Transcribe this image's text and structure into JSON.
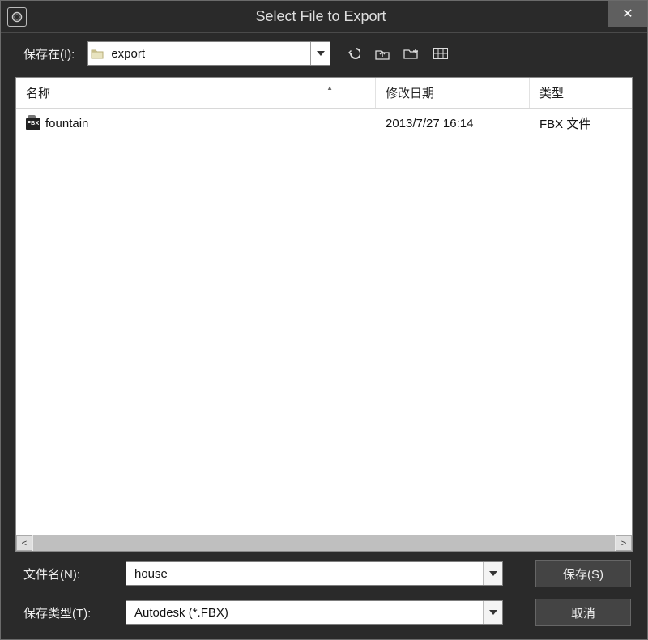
{
  "window": {
    "title": "Select File to Export",
    "close_glyph": "✕"
  },
  "look_in": {
    "label": "保存在(I):",
    "folder_name": "export"
  },
  "columns": {
    "name": "名称",
    "modified": "修改日期",
    "type": "类型"
  },
  "files": [
    {
      "icon": "fbx",
      "name": "fountain",
      "modified": "2013/7/27 16:14",
      "type": "FBX 文件"
    }
  ],
  "file_name": {
    "label": "文件名(N):",
    "value": "house"
  },
  "save_type": {
    "label": "保存类型(T):",
    "value": "Autodesk (*.FBX)"
  },
  "buttons": {
    "save": "保存(S)",
    "cancel": "取消"
  },
  "scroll": {
    "left": "<",
    "right": ">"
  },
  "sort_indicator": "▲"
}
